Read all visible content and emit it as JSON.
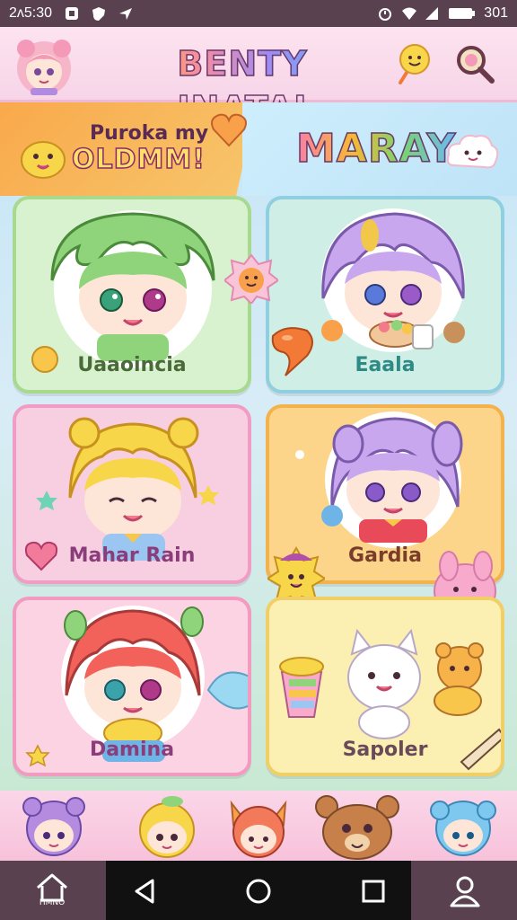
{
  "status_bar": {
    "time": "2ʌ5:30",
    "battery": "301"
  },
  "header": {
    "title": "BENTY INATAI",
    "icons": [
      "avatar",
      "lollipop-icon",
      "search-icon"
    ]
  },
  "banner": {
    "left_small": "Puroka my",
    "left_big": "OLDMM!",
    "right_title": "MARAY"
  },
  "cards": [
    {
      "label": "Uaaoincia"
    },
    {
      "label": "Eaala"
    },
    {
      "label": "Mahar Rain"
    },
    {
      "label": "Gardia"
    },
    {
      "label": "Damina"
    },
    {
      "label": "Sapoler"
    }
  ],
  "nav": {
    "home_label": "HMNO",
    "icons": [
      "home-icon",
      "back-icon",
      "home-circle-icon",
      "recents-icon",
      "profile-icon"
    ]
  },
  "colors": {
    "status_bar": "#5a4150",
    "header_bg": "#fde3ef",
    "accent_pink": "#f19cc4",
    "accent_green": "#a7d98e",
    "accent_yellow": "#f4b24c"
  }
}
